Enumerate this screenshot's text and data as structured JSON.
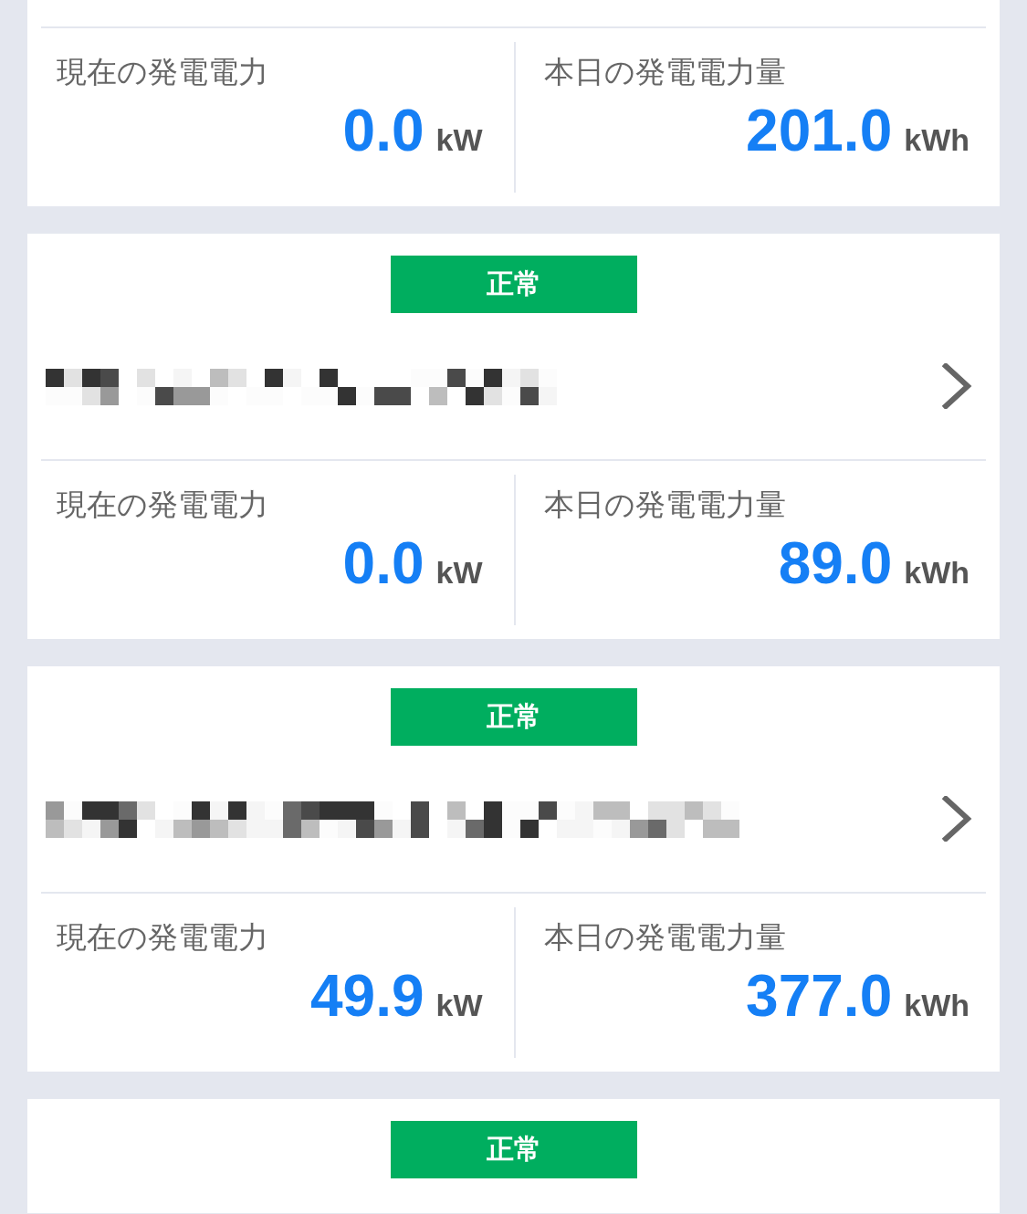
{
  "stations": [
    {
      "metrics": [
        {
          "label": "現在の発電電力",
          "value": "0.0",
          "unit": "kW"
        },
        {
          "label": "本日の発電電力量",
          "value": "201.0",
          "unit": "kWh"
        }
      ]
    },
    {
      "status": {
        "label": "正常",
        "kind": "normal"
      },
      "name_redacted": true,
      "metrics": [
        {
          "label": "現在の発電電力",
          "value": "0.0",
          "unit": "kW"
        },
        {
          "label": "本日の発電電力量",
          "value": "89.0",
          "unit": "kWh"
        }
      ]
    },
    {
      "status": {
        "label": "正常",
        "kind": "normal"
      },
      "name_redacted": true,
      "metrics": [
        {
          "label": "現在の発電電力",
          "value": "49.9",
          "unit": "kW"
        },
        {
          "label": "本日の発電電力量",
          "value": "377.0",
          "unit": "kWh"
        }
      ]
    },
    {
      "status": {
        "label": "正常",
        "kind": "normal"
      }
    }
  ]
}
